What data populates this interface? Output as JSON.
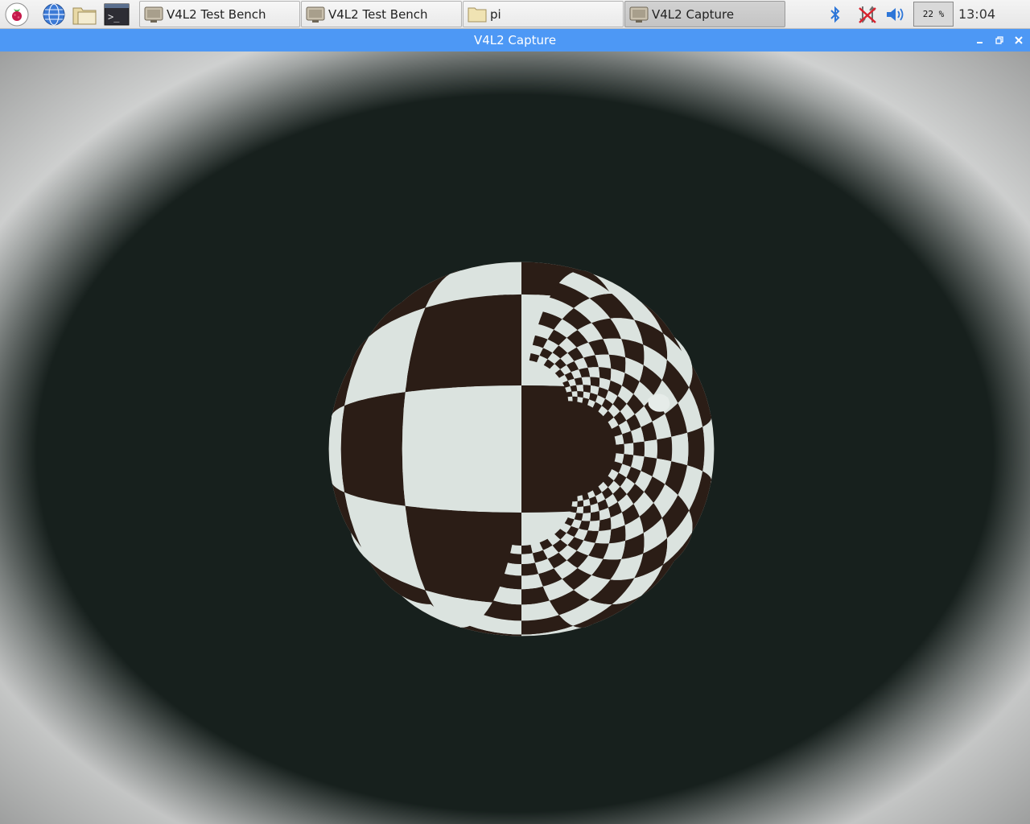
{
  "taskbar": {
    "launchers": [
      {
        "name": "raspberry-menu-icon"
      },
      {
        "name": "web-browser-icon"
      },
      {
        "name": "file-manager-icon"
      },
      {
        "name": "terminal-icon"
      }
    ],
    "tasks": [
      {
        "label": "V4L2 Test Bench",
        "icon": "v4l2-app-icon",
        "active": false
      },
      {
        "label": "V4L2 Test Bench",
        "icon": "v4l2-app-icon",
        "active": false
      },
      {
        "label": "pi",
        "icon": "folder-icon",
        "active": false
      },
      {
        "label": "V4L2 Capture",
        "icon": "v4l2-app-icon",
        "active": true
      }
    ],
    "tray": {
      "bluetooth_icon": "bluetooth-icon",
      "network_icon": "network-disconnected-icon",
      "volume_icon": "volume-icon",
      "cpu_usage": "22 %",
      "clock": "13:04"
    }
  },
  "window": {
    "title": "V4L2 Capture",
    "controls": [
      "minimize-icon",
      "maximize-icon",
      "close-icon"
    ]
  },
  "capture": {
    "subject": "fisheye view of checkerboard calibration pattern",
    "colors": {
      "dark_square": "#2b1d16",
      "light_square": "#dbe3df",
      "rim_glare": "#f2f7f6",
      "titlebar": "#4d98f5"
    }
  }
}
